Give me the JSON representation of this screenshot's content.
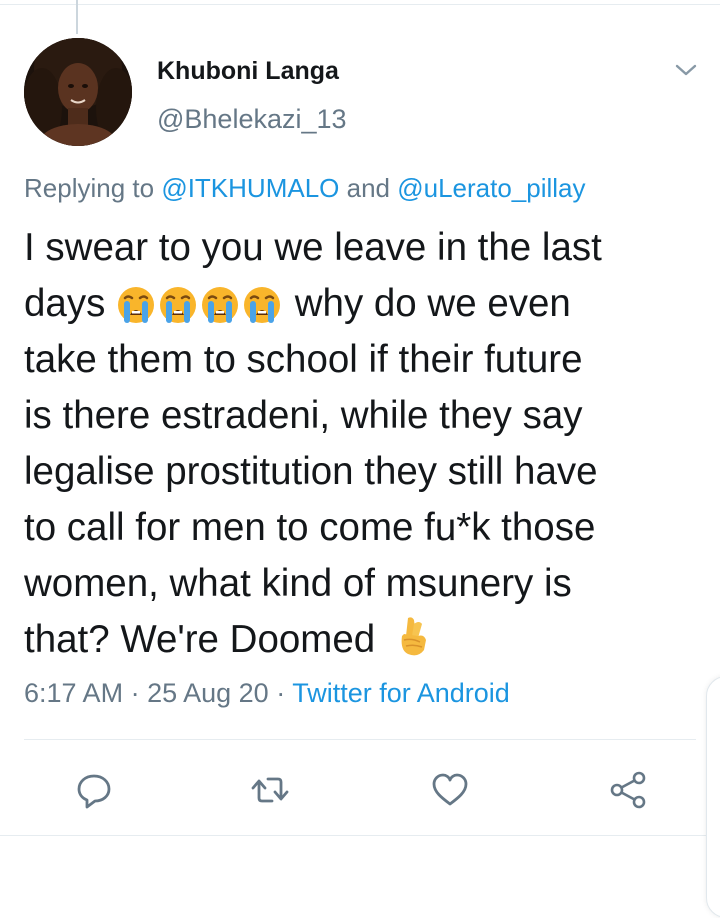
{
  "tweet": {
    "author_name": "Khuboni Langa",
    "author_handle": "@Bhelekazi_13",
    "reply": {
      "prefix": "Replying to ",
      "mention_1": "@ITKHUMALO",
      "conjunction": " and ",
      "mention_2": "@uLerato_pillay"
    },
    "text_lines": [
      "I swear to you we leave in the last",
      "days",
      "why do we even",
      "take them to school if their future",
      "is there estradeni, while they say",
      "legalise prostitution they still have",
      "to call for men to come fu*k those",
      "women, what kind of msunery is",
      "that? We're Doomed"
    ],
    "emoji": {
      "crying": "loudly-crying-face",
      "crying_count": 4,
      "crossed": "crossed-fingers"
    },
    "time": "6:17 AM",
    "separator": " · ",
    "date": "25 Aug 20",
    "client": "Twitter for Android"
  },
  "actions": {
    "reply": "reply-icon",
    "retweet": "retweet-icon",
    "like": "heart-icon",
    "share": "share-icon"
  },
  "colors": {
    "text": "#14171a",
    "secondary": "#657786",
    "link": "#1b95e0",
    "divider": "#e6ecf0"
  }
}
